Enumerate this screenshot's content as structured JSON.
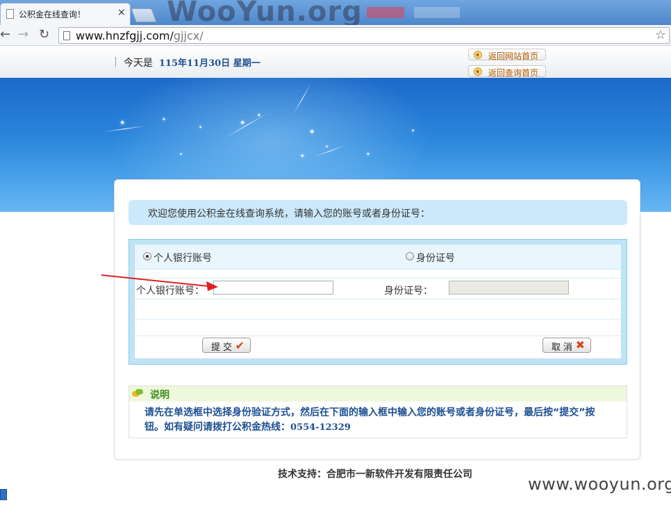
{
  "browser": {
    "tab_title": "公积金在线查询！",
    "tab_close": "×",
    "watermark_top": "WooYun.org",
    "url_host": "www.hnzfgjj.com/",
    "url_path": "gjjcx/"
  },
  "header": {
    "date_prefix": "今天是",
    "date_value": "115年11月30日 星期一",
    "links": [
      "返回网站首页",
      "返回查询首页"
    ]
  },
  "welcome_text": "欢迎您使用公积金在线查询系统，请输入您的账号或者身份证号：",
  "form": {
    "radio_options": [
      "个人银行账号",
      "身份证号"
    ],
    "selected_radio": "个人银行账号",
    "account_label": "个人银行账号：",
    "id_label": "身份证号：",
    "account_value": "",
    "id_value": "",
    "submit_label": "提交",
    "cancel_label": "取消"
  },
  "note": {
    "title": "说明",
    "text": "请先在单选框中选择身份验证方式，然后在下面的输入框中输入您的账号或者身份证号，最后按“提交”按钮。如有疑问请拨打公积金热线：",
    "hotline": "0554-12329"
  },
  "footer_text": "技术支持：合肥市一新软件开发有限责任公司",
  "watermark_bottom": "www.wooyun.org",
  "colors": {
    "banner": "#2b86db",
    "link_text": "#1d4f91",
    "note_title": "#3f8c1e",
    "arrow": "#e02020"
  }
}
